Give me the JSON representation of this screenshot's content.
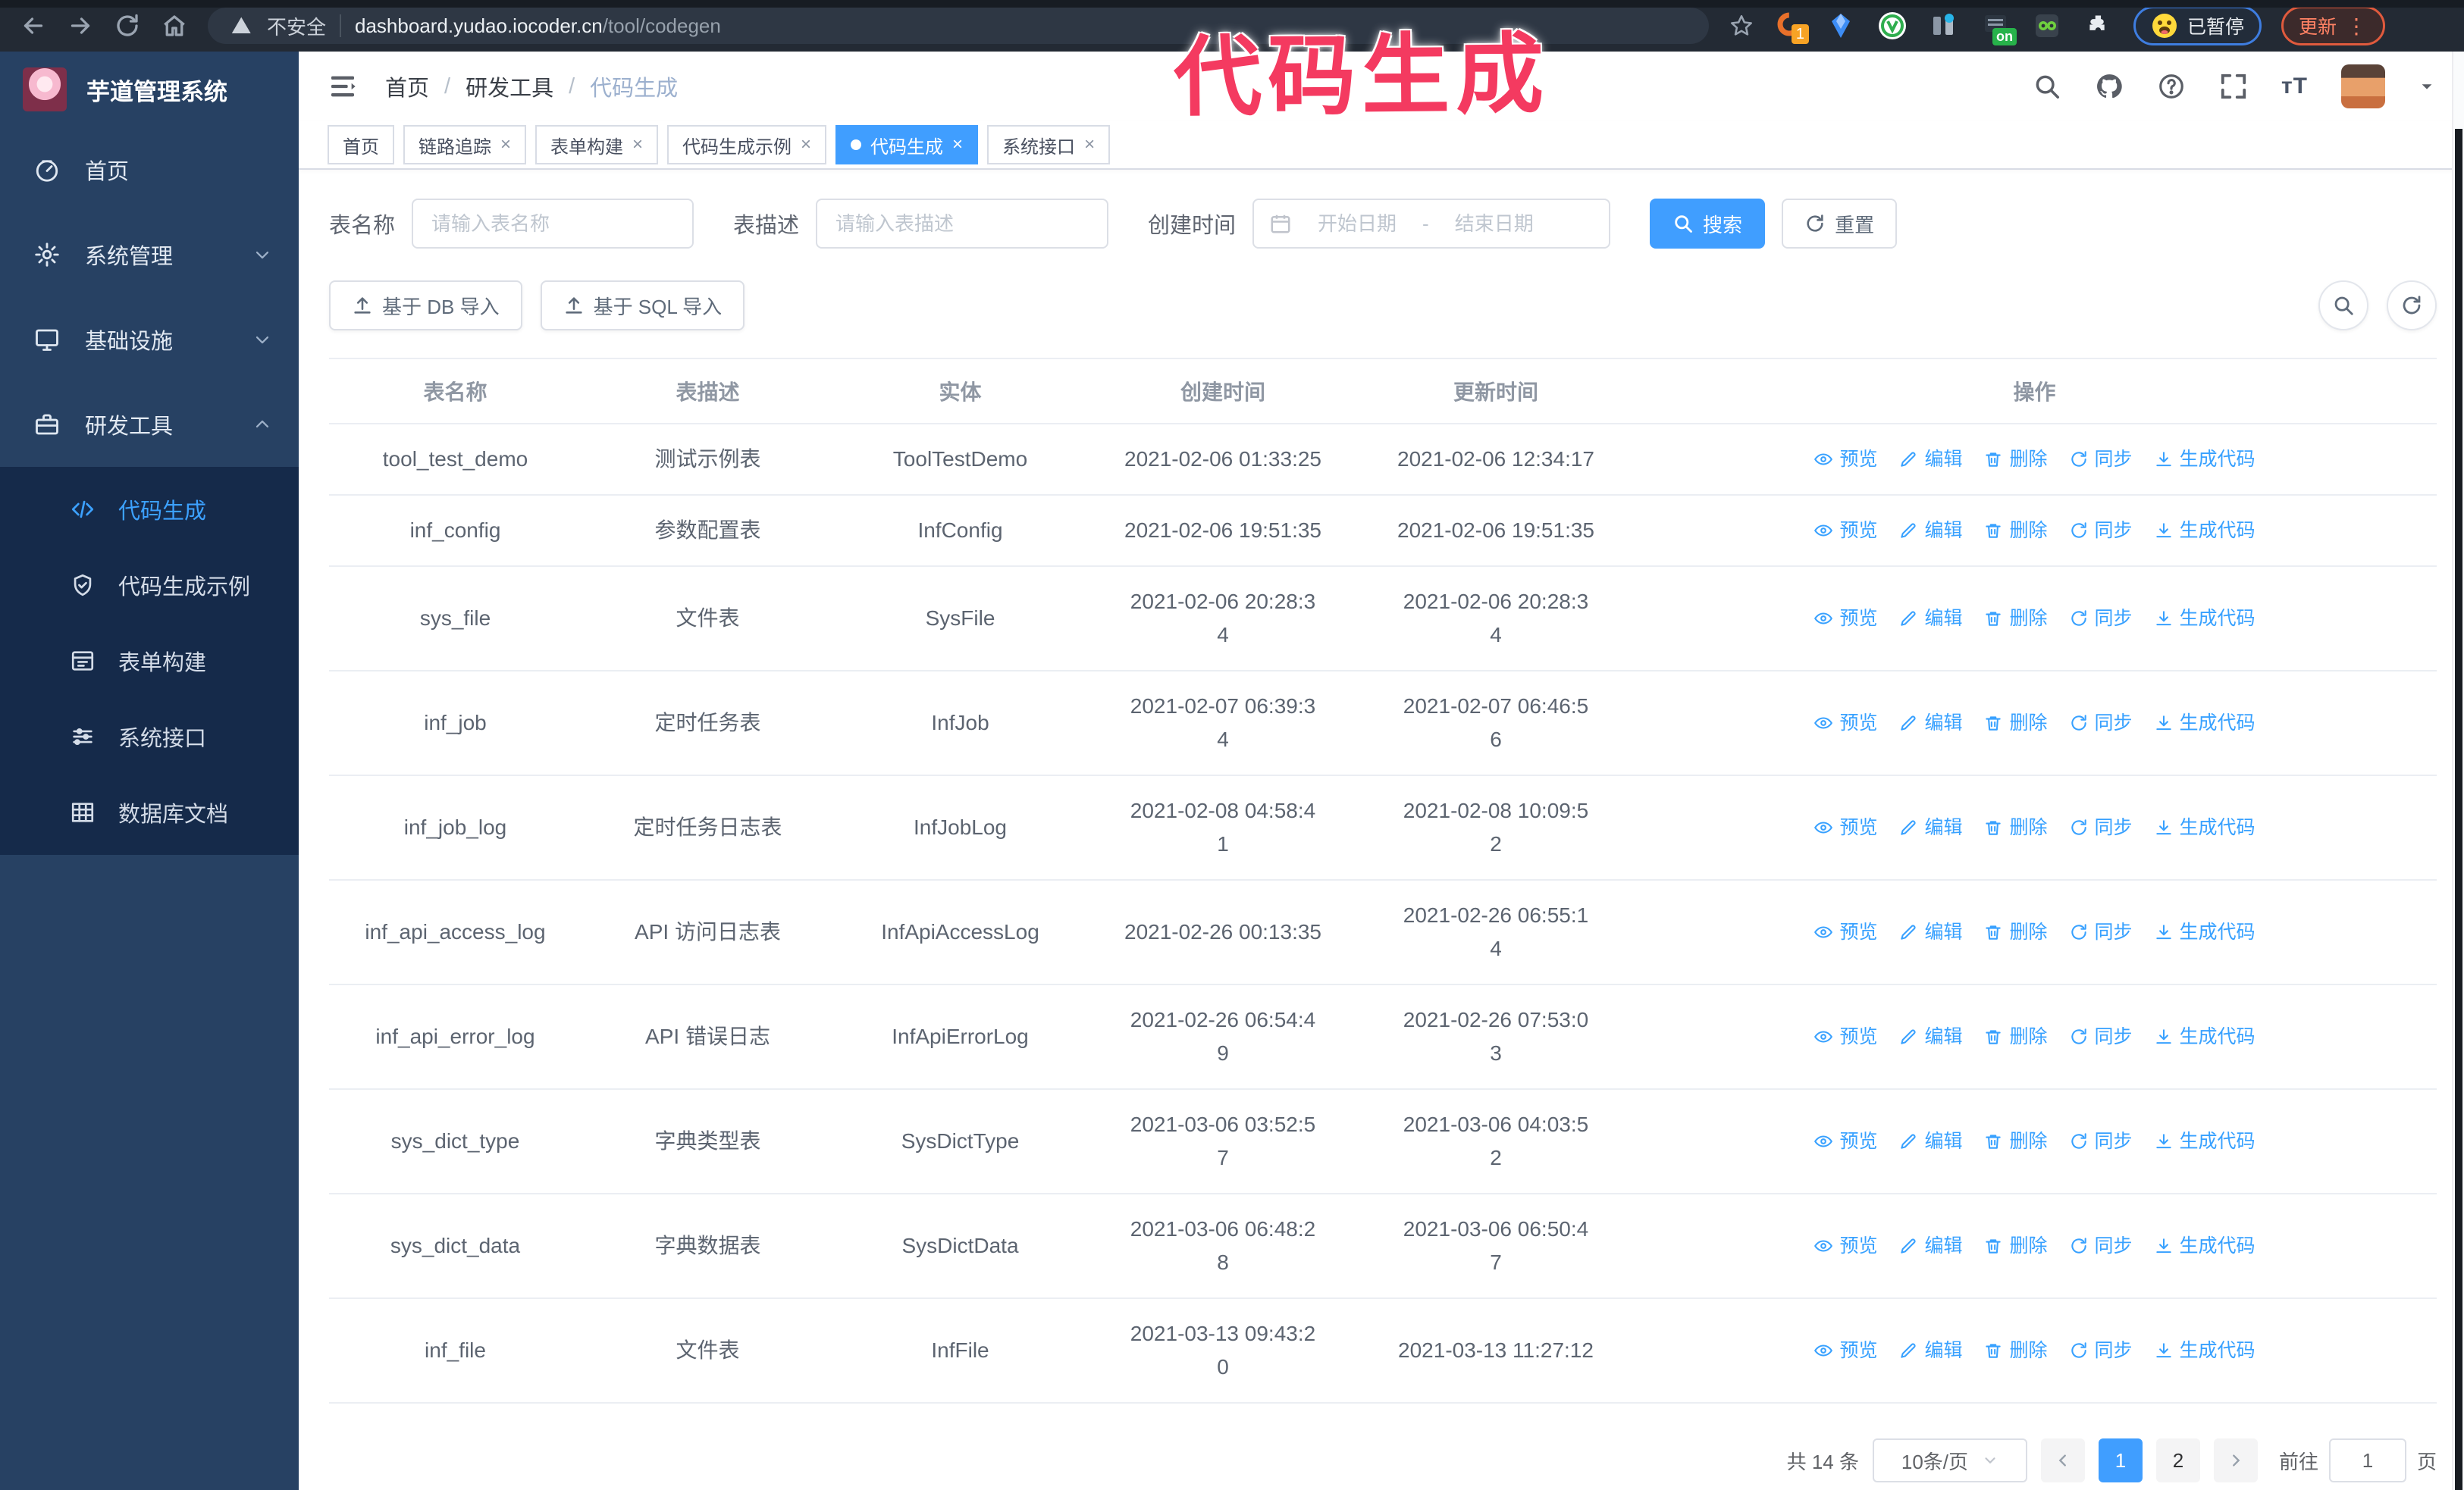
{
  "chrome": {
    "security_label": "不安全",
    "url_domain": "dashboard.yudao.iocoder.cn",
    "url_path": "/tool/codegen",
    "paused_badge": "已暂停",
    "update_button": "更新"
  },
  "overlay_text": "代码生成",
  "header": {
    "logo_title": "芋道管理系统",
    "breadcrumb": [
      "首页",
      "研发工具",
      "代码生成"
    ]
  },
  "sidebar": {
    "items": [
      {
        "label": "首页",
        "icon": "dashboard-icon",
        "arrow": ""
      },
      {
        "label": "系统管理",
        "icon": "gear-icon",
        "arrow": "down"
      },
      {
        "label": "基础设施",
        "icon": "monitor-icon",
        "arrow": "down"
      },
      {
        "label": "研发工具",
        "icon": "toolbox-icon",
        "arrow": "up"
      }
    ],
    "submenu": [
      {
        "label": "代码生成",
        "icon": "code-icon",
        "active": true
      },
      {
        "label": "代码生成示例",
        "icon": "check-badge-icon",
        "active": false
      },
      {
        "label": "表单构建",
        "icon": "form-icon",
        "active": false
      },
      {
        "label": "系统接口",
        "icon": "api-icon",
        "active": false
      },
      {
        "label": "数据库文档",
        "icon": "db-doc-icon",
        "active": false
      }
    ]
  },
  "tabs": [
    {
      "label": "首页",
      "closable": false,
      "active": false
    },
    {
      "label": "链路追踪",
      "closable": true,
      "active": false
    },
    {
      "label": "表单构建",
      "closable": true,
      "active": false
    },
    {
      "label": "代码生成示例",
      "closable": true,
      "active": false
    },
    {
      "label": "代码生成",
      "closable": true,
      "active": true
    },
    {
      "label": "系统接口",
      "closable": true,
      "active": false
    }
  ],
  "search": {
    "name_label": "表名称",
    "name_placeholder": "请输入表名称",
    "desc_label": "表描述",
    "desc_placeholder": "请输入表描述",
    "time_label": "创建时间",
    "start_placeholder": "开始日期",
    "range_separator": "-",
    "end_placeholder": "结束日期",
    "search_button": "搜索",
    "reset_button": "重置"
  },
  "toolbar": {
    "db_import": "基于 DB 导入",
    "sql_import": "基于 SQL 导入"
  },
  "table": {
    "columns": [
      "表名称",
      "表描述",
      "实体",
      "创建时间",
      "更新时间",
      "操作"
    ],
    "actions": [
      {
        "label": "预览",
        "icon": "eye-icon"
      },
      {
        "label": "编辑",
        "icon": "edit-icon"
      },
      {
        "label": "删除",
        "icon": "delete-icon"
      },
      {
        "label": "同步",
        "icon": "sync-icon"
      },
      {
        "label": "生成代码",
        "icon": "download-icon"
      }
    ],
    "rows": [
      {
        "name": "tool_test_demo",
        "desc": "测试示例表",
        "entity": "ToolTestDemo",
        "created": "2021-02-06 01:33:25",
        "updated": "2021-02-06 12:34:17"
      },
      {
        "name": "inf_config",
        "desc": "参数配置表",
        "entity": "InfConfig",
        "created": "2021-02-06 19:51:35",
        "updated": "2021-02-06 19:51:35"
      },
      {
        "name": "sys_file",
        "desc": "文件表",
        "entity": "SysFile",
        "created": "2021-02-06 20:28:3\n4",
        "updated": "2021-02-06 20:28:3\n4"
      },
      {
        "name": "inf_job",
        "desc": "定时任务表",
        "entity": "InfJob",
        "created": "2021-02-07 06:39:3\n4",
        "updated": "2021-02-07 06:46:5\n6"
      },
      {
        "name": "inf_job_log",
        "desc": "定时任务日志表",
        "entity": "InfJobLog",
        "created": "2021-02-08 04:58:4\n1",
        "updated": "2021-02-08 10:09:5\n2"
      },
      {
        "name": "inf_api_access_log",
        "desc": "API 访问日志表",
        "entity": "InfApiAccessLog",
        "created": "2021-02-26 00:13:35",
        "updated": "2021-02-26 06:55:1\n4"
      },
      {
        "name": "inf_api_error_log",
        "desc": "API 错误日志",
        "entity": "InfApiErrorLog",
        "created": "2021-02-26 06:54:4\n9",
        "updated": "2021-02-26 07:53:0\n3"
      },
      {
        "name": "sys_dict_type",
        "desc": "字典类型表",
        "entity": "SysDictType",
        "created": "2021-03-06 03:52:5\n7",
        "updated": "2021-03-06 04:03:5\n2"
      },
      {
        "name": "sys_dict_data",
        "desc": "字典数据表",
        "entity": "SysDictData",
        "created": "2021-03-06 06:48:2\n8",
        "updated": "2021-03-06 06:50:4\n7"
      },
      {
        "name": "inf_file",
        "desc": "文件表",
        "entity": "InfFile",
        "created": "2021-03-13 09:43:2\n0",
        "updated": "2021-03-13 11:27:12"
      }
    ]
  },
  "pagination": {
    "total": "共 14 条",
    "page_size": "10条/页",
    "pages": [
      {
        "label": "1",
        "active": true
      },
      {
        "label": "2",
        "active": false
      }
    ],
    "goto_label": "前往",
    "goto_value": "1",
    "page_suffix": "页"
  },
  "colors": {
    "accent": "#409eff",
    "sidebar_bg": "#274163",
    "submenu_bg": "#152a4a",
    "annotation": "#f43a60"
  }
}
